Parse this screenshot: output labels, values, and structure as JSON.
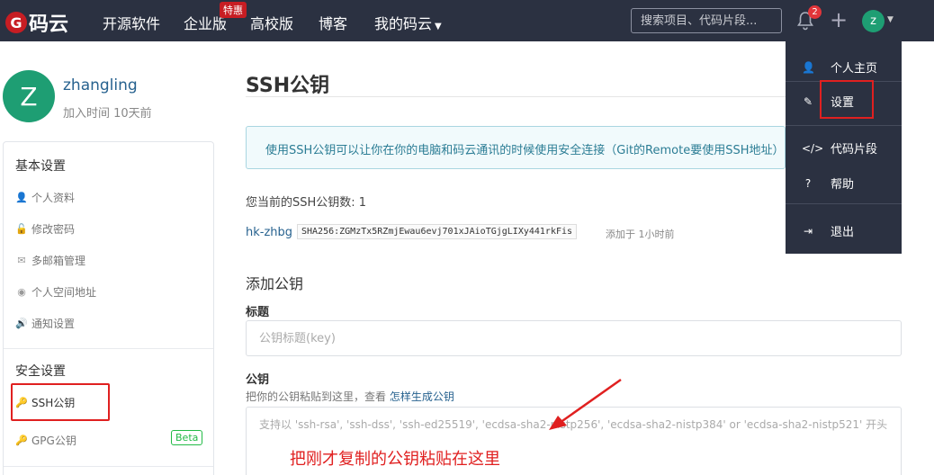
{
  "brand": {
    "name": "码云",
    "mark": "G"
  },
  "nav": {
    "items": [
      "开源软件",
      "企业版",
      "高校版",
      "博客",
      "我的码云"
    ],
    "hot_badge": "特惠",
    "search_placeholder": "搜索项目、代码片段...",
    "notification_count": "2",
    "avatar_letter": "z"
  },
  "profile": {
    "avatar_letter": "Z",
    "name": "zhangling",
    "joined": "加入时间 10天前"
  },
  "sidebar": {
    "group_basic": "基本设置",
    "basic_items": [
      "个人资料",
      "修改密码",
      "多邮箱管理",
      "个人空间地址",
      "通知设置"
    ],
    "group_security": "安全设置",
    "security_items": [
      "SSH公钥",
      "GPG公钥"
    ],
    "beta": "Beta"
  },
  "main": {
    "title": "SSH公钥",
    "info": "使用SSH公钥可以让你在你的电脑和码云通讯的时候使用安全连接（Git的Remote要使用SSH地址）",
    "key_count": "您当前的SSH公钥数: 1",
    "key_name": "hk-zhbg",
    "key_fingerprint": "SHA256:ZGMzTx5RZmjEwau6evj701xJAioTGjgLIXy441rkFis",
    "key_added": "添加于 1小时前",
    "add_title": "添加公钥",
    "label_title": "标题",
    "title_placeholder": "公钥标题(key)",
    "label_key": "公钥",
    "hint_prefix": "把你的公钥粘贴到这里，查看 ",
    "hint_link": "怎样生成公钥",
    "key_placeholder": "支持以 'ssh-rsa', 'ssh-dss', 'ssh-ed25519', 'ecdsa-sha2-nistp256', 'ecdsa-sha2-nistp384' or 'ecdsa-sha2-nistp521' 开头"
  },
  "annotation": "把刚才复制的公钥粘贴在这里",
  "dropdown": {
    "items": [
      "个人主页",
      "设置",
      "代码片段",
      "帮助",
      "退出"
    ]
  },
  "colors": {
    "accent_red": "#e02020",
    "nav_bg": "#2b3141",
    "avatar_green": "#1e9e73"
  }
}
